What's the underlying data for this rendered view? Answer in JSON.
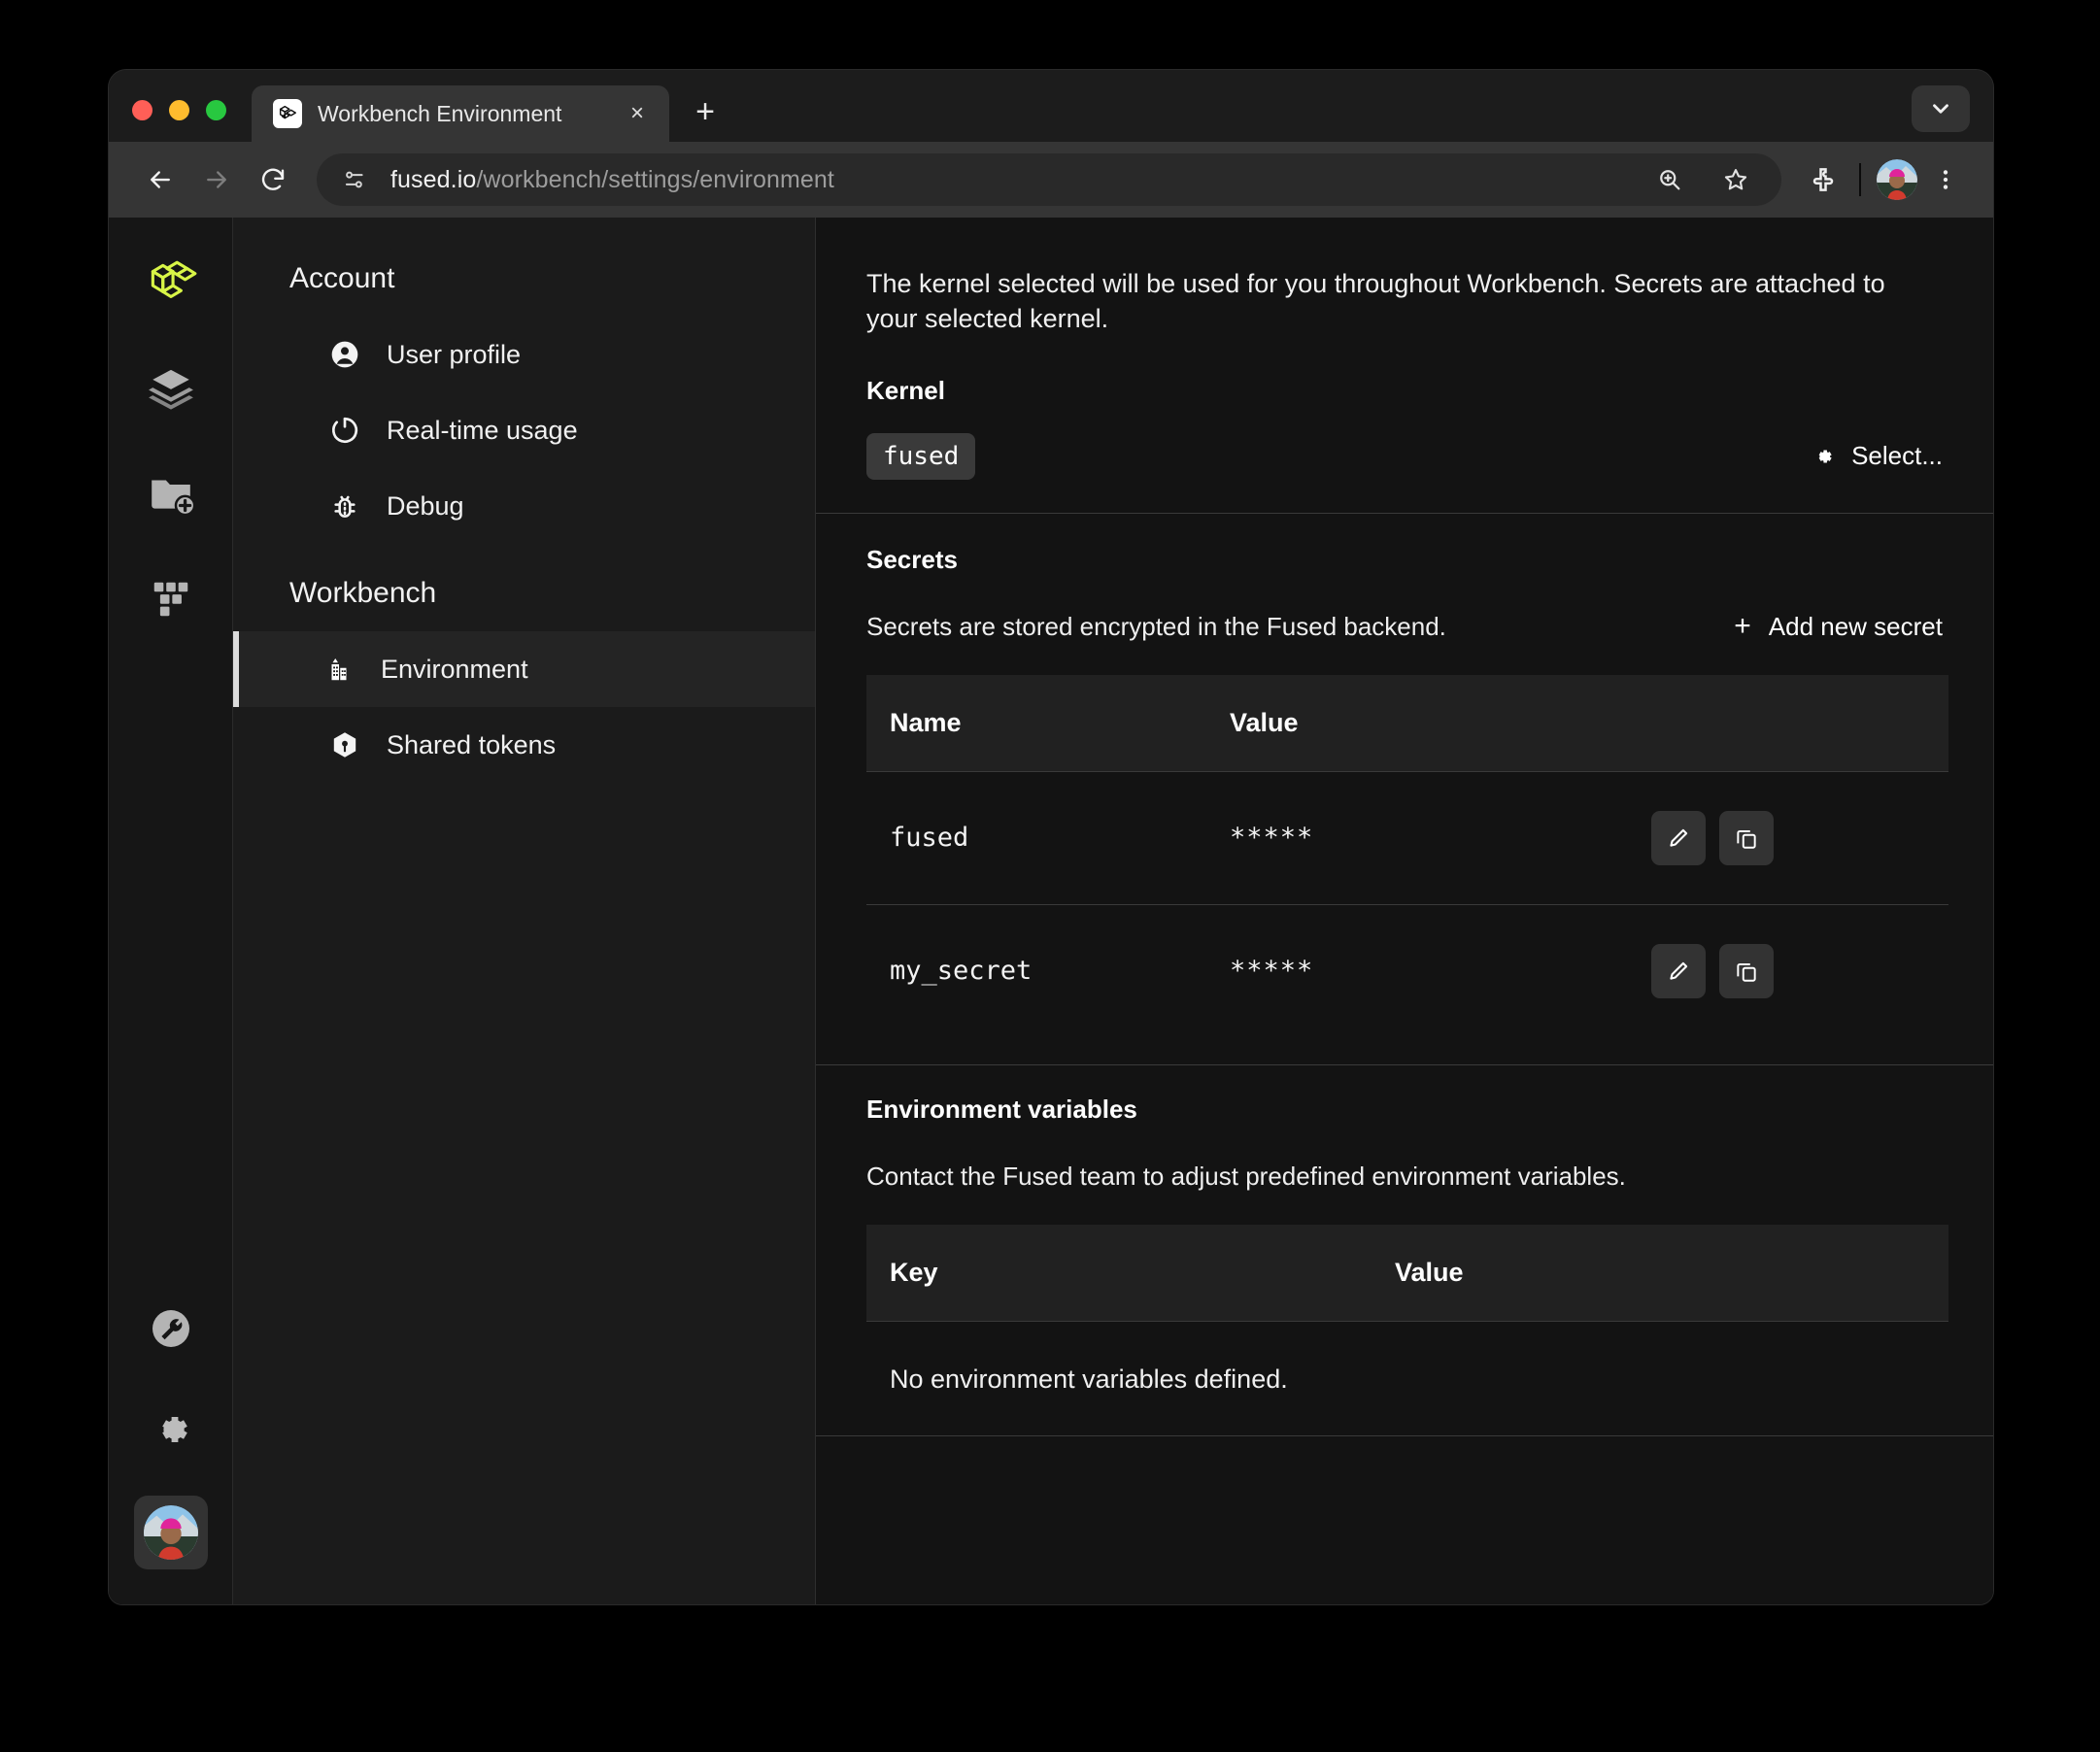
{
  "browser": {
    "tab": {
      "title": "Workbench Environment",
      "favicon": "fused-logo-icon",
      "close": "×"
    },
    "new_tab_label": "+",
    "tab_list_icon": "chevron-down-icon",
    "toolbar": {
      "back_icon": "back-arrow-icon",
      "forward_icon": "forward-arrow-icon",
      "reload_icon": "reload-icon",
      "site_info_icon": "site-settings-icon",
      "url_host": "fused.io",
      "url_path": "/workbench/settings/environment",
      "zoom_icon": "zoom-in-icon",
      "bookmark_icon": "star-icon",
      "extensions_icon": "puzzle-piece-icon",
      "profile_icon": "profile-avatar",
      "menu_icon": "three-dot-menu-icon"
    }
  },
  "rail": {
    "items": [
      {
        "name": "fused-logo",
        "icon": "fused-logo-icon",
        "color": "#d8f547"
      },
      {
        "name": "layers",
        "icon": "layers-icon"
      },
      {
        "name": "new-folder",
        "icon": "folder-plus-icon"
      },
      {
        "name": "blocks",
        "icon": "grid-blocks-icon"
      }
    ],
    "bottom": [
      {
        "name": "tools",
        "icon": "wrench-circle-icon"
      },
      {
        "name": "settings",
        "icon": "gear-icon"
      },
      {
        "name": "account",
        "icon": "profile-avatar"
      }
    ]
  },
  "settings_nav": {
    "groups": [
      {
        "title": "Account",
        "items": [
          {
            "label": "User profile",
            "icon": "user-circle-icon",
            "active": false
          },
          {
            "label": "Real-time usage",
            "icon": "gauge-icon",
            "active": false
          },
          {
            "label": "Debug",
            "icon": "bug-icon",
            "active": false
          }
        ]
      },
      {
        "title": "Workbench",
        "items": [
          {
            "label": "Environment",
            "icon": "building-icon",
            "active": true
          },
          {
            "label": "Shared tokens",
            "icon": "cube-icon",
            "active": false
          }
        ]
      }
    ]
  },
  "main": {
    "intro": "The kernel selected will be used for you throughout Workbench. Secrets are attached to your selected kernel.",
    "kernel": {
      "heading": "Kernel",
      "badge": "fused",
      "select_label": "Select...",
      "select_icon": "gear-icon"
    },
    "secrets": {
      "heading": "Secrets",
      "description": "Secrets are stored encrypted in the Fused backend.",
      "add_label": "Add new secret",
      "add_icon": "plus-icon",
      "columns": [
        "Name",
        "Value"
      ],
      "rows": [
        {
          "name": "fused",
          "value": "*****",
          "edit_icon": "pencil-icon",
          "copy_icon": "copy-icon"
        },
        {
          "name": "my_secret",
          "value": "*****",
          "edit_icon": "pencil-icon",
          "copy_icon": "copy-icon"
        }
      ]
    },
    "env_vars": {
      "heading": "Environment variables",
      "description": "Contact the Fused team to adjust predefined environment variables.",
      "columns": [
        "Key",
        "Value"
      ],
      "empty_message": "No environment variables defined."
    }
  }
}
